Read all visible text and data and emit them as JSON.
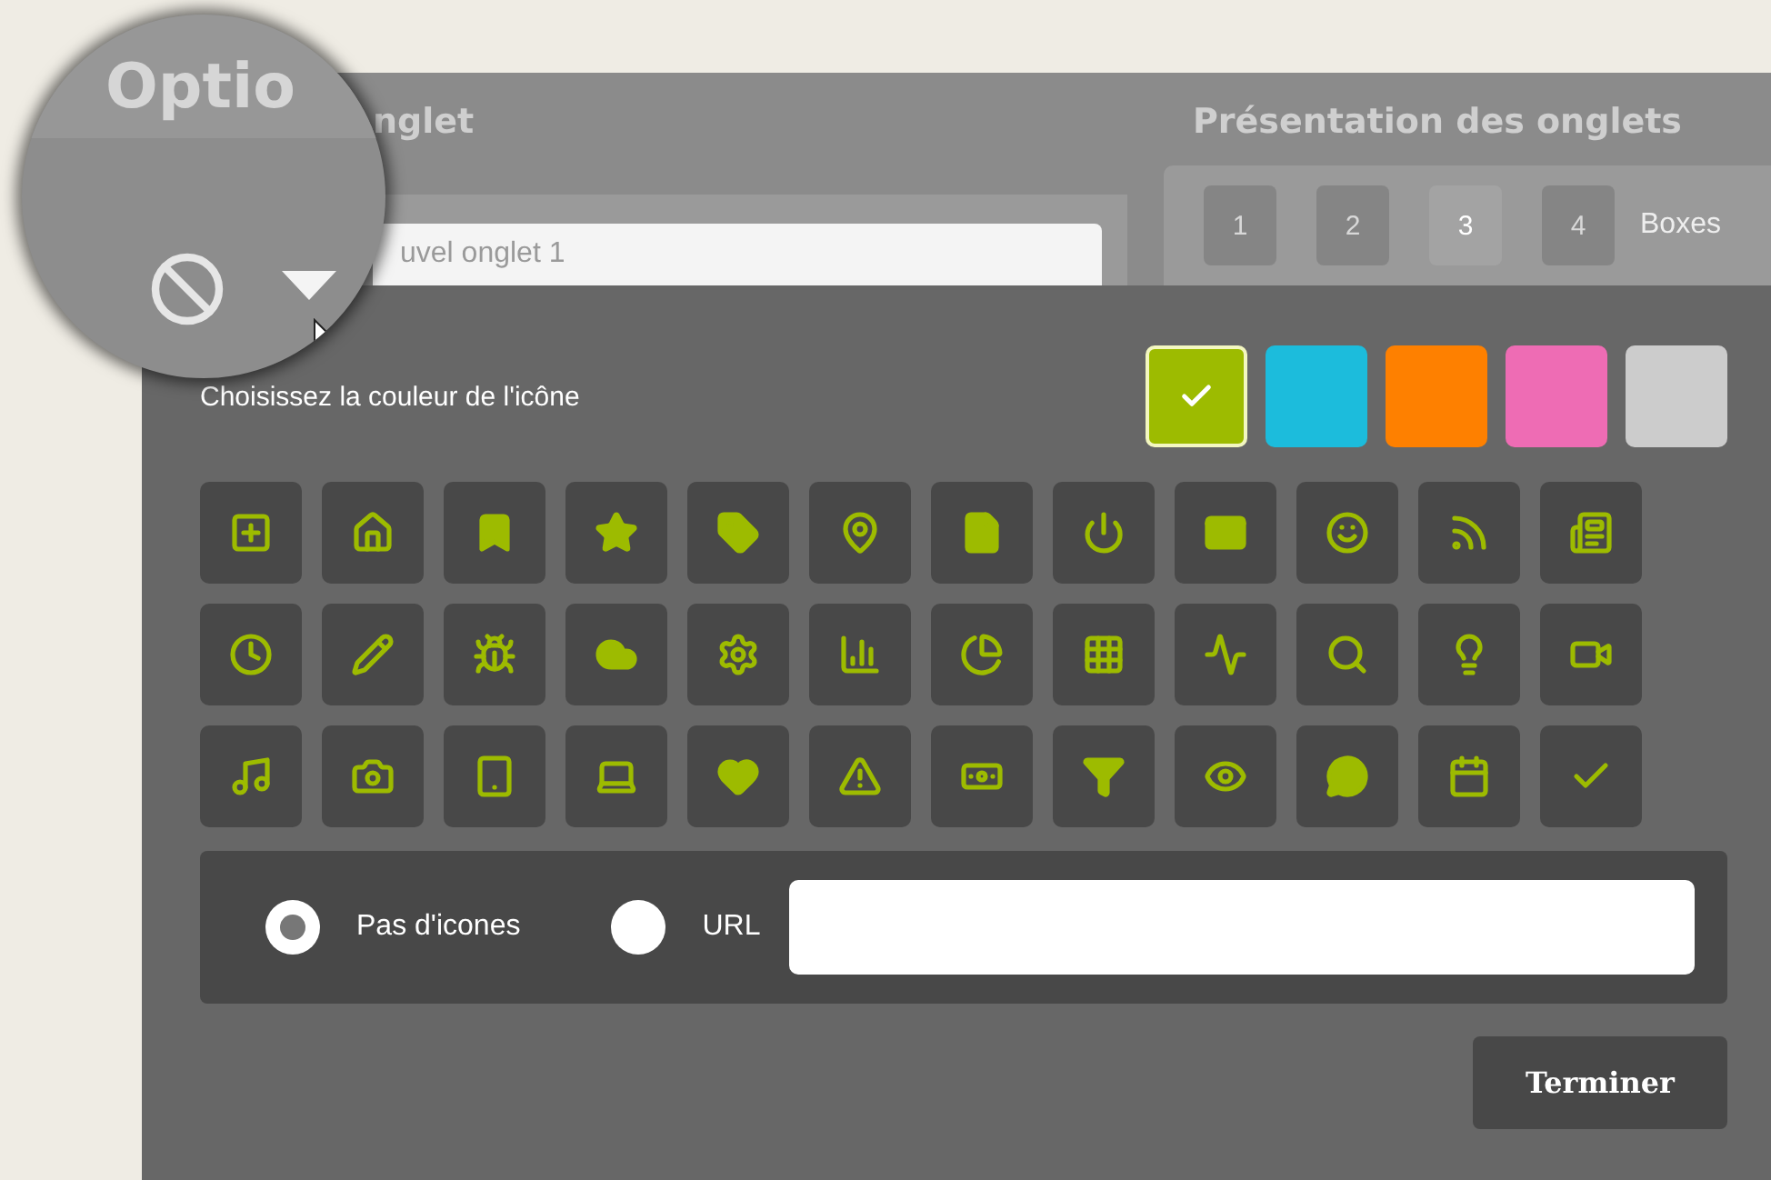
{
  "magnifier": {
    "title": "Optio"
  },
  "tab_name": {
    "title": "nglet",
    "value": "uvel onglet 1"
  },
  "tab_layout": {
    "title": "Présentation des onglets",
    "options": [
      {
        "label": "1",
        "selected": false
      },
      {
        "label": "2",
        "selected": false
      },
      {
        "label": "3",
        "selected": true
      },
      {
        "label": "4",
        "selected": false
      }
    ],
    "trailing_label": "Boxes"
  },
  "icon_color": {
    "label": "Choisissez la couleur de l'icône",
    "colors": [
      {
        "color": "#9dbb00",
        "selected": true
      },
      {
        "color": "#1cbcdc",
        "selected": false
      },
      {
        "color": "#fe8000",
        "selected": false
      },
      {
        "color": "#ee6cb4",
        "selected": false
      },
      {
        "color": "#cccccc",
        "selected": false
      }
    ]
  },
  "icon_source": [
    {
      "label": "Pas d'icones",
      "selected": true,
      "kind": "none"
    },
    {
      "label": "URL",
      "selected": false,
      "kind": "url"
    }
  ],
  "finish_button": "Terminer"
}
